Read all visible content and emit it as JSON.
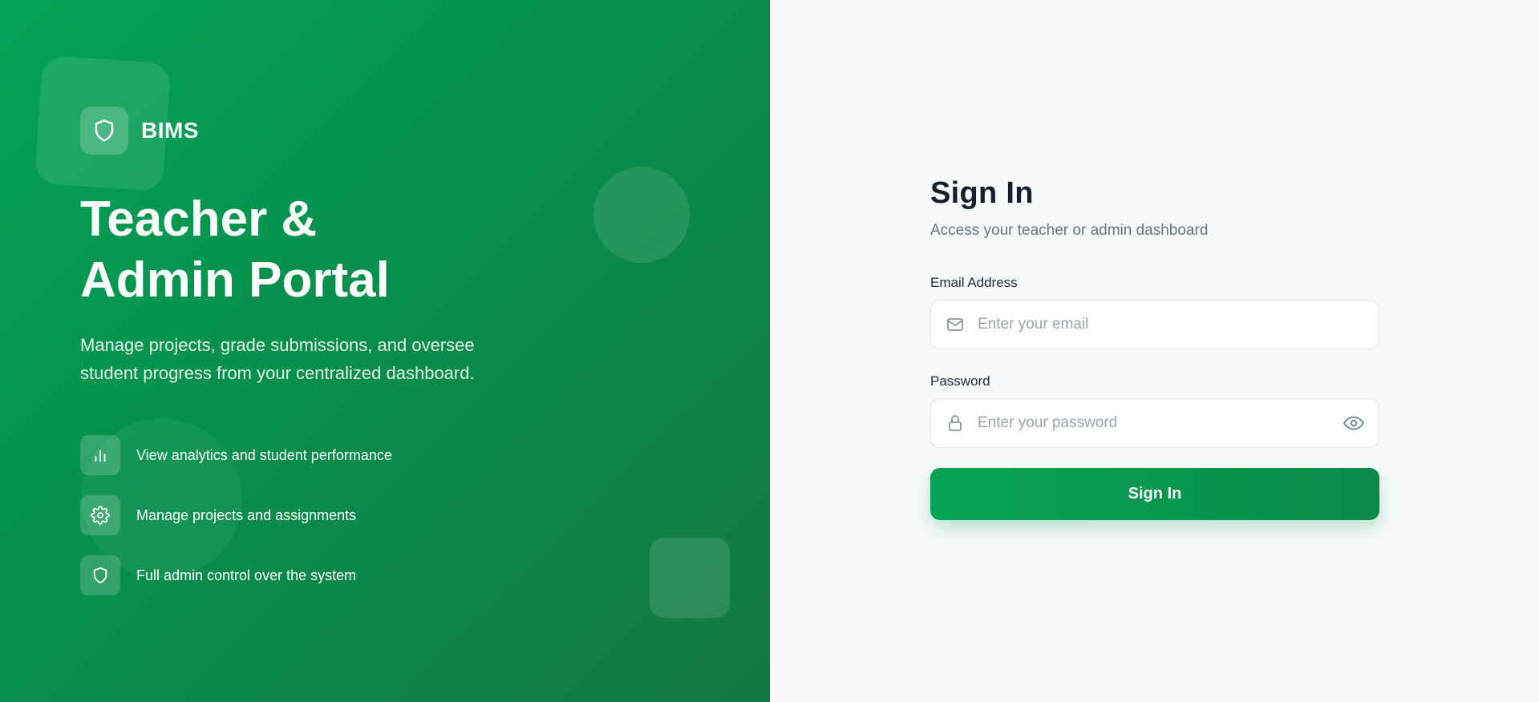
{
  "brand": {
    "name": "BIMS",
    "icon": "shield-icon"
  },
  "hero": {
    "title_line1": "Teacher &",
    "title_line2": "Admin Portal",
    "description": "Manage projects, grade submissions, and oversee student progress from your centralized dashboard."
  },
  "features": [
    {
      "icon": "bar-chart-icon",
      "text": "View analytics and student performance"
    },
    {
      "icon": "gear-icon",
      "text": "Manage projects and assignments"
    },
    {
      "icon": "shield-icon",
      "text": "Full admin control over the system"
    }
  ],
  "form": {
    "title": "Sign In",
    "subtitle": "Access your teacher or admin dashboard",
    "email_label": "Email Address",
    "email_placeholder": "Enter your email",
    "password_label": "Password",
    "password_placeholder": "Enter your password",
    "submit_label": "Sign In"
  },
  "colors": {
    "primary": "#04a356",
    "primary_dark": "#137842",
    "heading": "#1a1d2e",
    "muted": "#6b7280",
    "background": "#f8f9fb"
  }
}
